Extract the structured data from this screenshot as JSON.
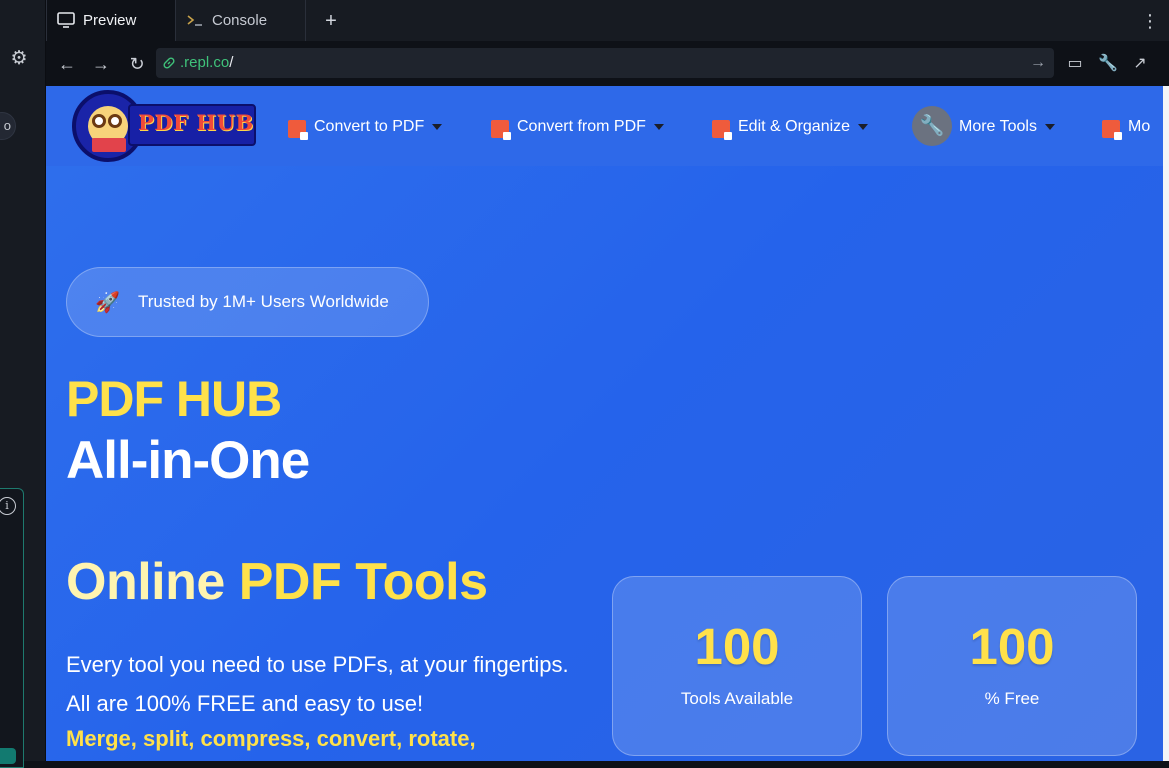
{
  "tabs": {
    "preview_label": "Preview",
    "console_label": "Console",
    "add_label": "+",
    "menu_label": "⋮"
  },
  "address": {
    "url_host": ".repl.co",
    "url_path": "/"
  },
  "side": {
    "pill_text": "o",
    "info_text": "i"
  },
  "site": {
    "logo_text": "PDF HUB",
    "nav": [
      {
        "label": "Convert to PDF",
        "icon": "pdf-convert-icon"
      },
      {
        "label": "Convert from PDF",
        "icon": "pdf-convert-icon"
      },
      {
        "label": "Edit & Organize",
        "icon": "pdf-edit-icon"
      },
      {
        "label": "More Tools",
        "icon": "wrench-icon"
      },
      {
        "label": "Mo",
        "icon": "pdf-convert-icon"
      }
    ],
    "trust_text": "Trusted by 1M+ Users Worldwide",
    "headline_line1": "PDF HUB",
    "headline_line2": "All-in-One",
    "headline_line3_word1": "Online",
    "headline_line3_word2": "PDF Tools",
    "description": "Every tool you need to use PDFs, at your fingertips. All are 100% FREE and easy to use!",
    "description_highlight": "Merge, split, compress, convert, rotate,",
    "stats": [
      {
        "number": "100",
        "label": "Tools Available"
      },
      {
        "number": "100",
        "label": "% Free"
      }
    ]
  },
  "colors": {
    "accent_yellow": "#ffe14a",
    "hero_blue": "#2563eb",
    "url_green": "#3fc27a"
  }
}
